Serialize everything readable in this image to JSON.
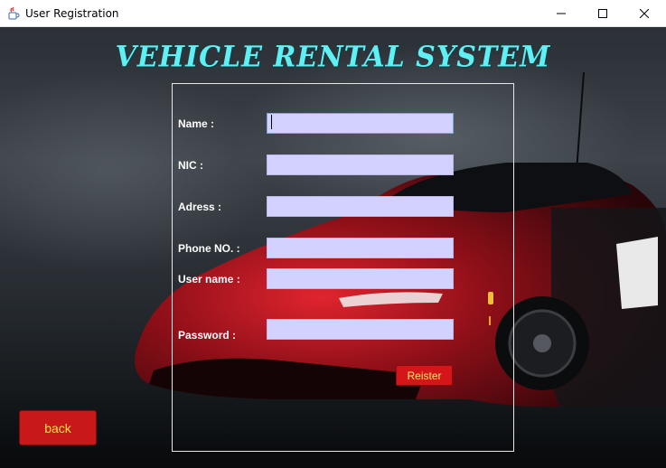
{
  "window": {
    "title": "User Registration",
    "icon": "java-cup-icon",
    "controls": [
      "minimize-icon",
      "maximize-icon",
      "close-icon"
    ]
  },
  "header": {
    "title": "VEHICLE RENTAL SYSTEM"
  },
  "form": {
    "fields": [
      {
        "label": "Name :",
        "value": ""
      },
      {
        "label": "NIC :",
        "value": ""
      },
      {
        "label": "Adress :",
        "value": ""
      },
      {
        "label": "Phone NO. :",
        "value": ""
      },
      {
        "label": "User name :",
        "value": ""
      },
      {
        "label": "Password :",
        "value": ""
      }
    ],
    "register_label": "Reister"
  },
  "back_label": "back",
  "colors": {
    "title": "#5ff0f4",
    "input_bg": "#d3d1ff",
    "button_bg": "#d4151a",
    "button_text": "#ffea6a"
  }
}
